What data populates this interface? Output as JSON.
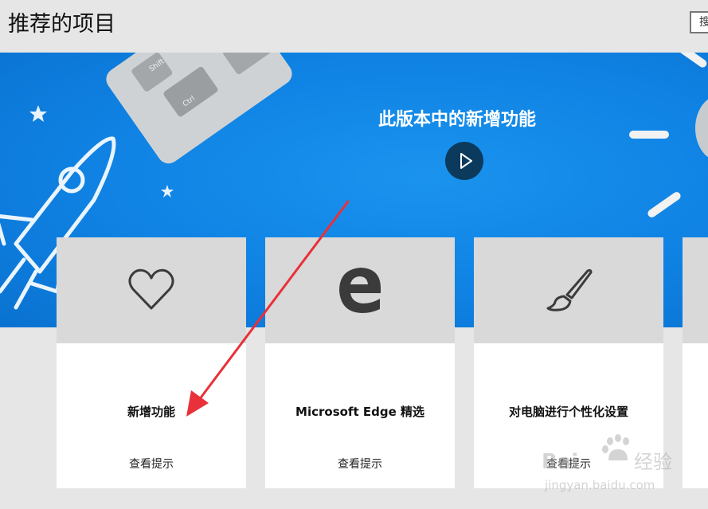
{
  "header": {
    "title": "推荐的项目",
    "search_label": "搜"
  },
  "hero": {
    "title": "此版本中的新增功能",
    "key_shift": "Shift",
    "key_ctrl": "Ctrl"
  },
  "cards": [
    {
      "title": "新增功能",
      "link": "查看提示",
      "icon": "heart-icon"
    },
    {
      "title": "Microsoft Edge 精选",
      "link": "查看提示",
      "icon": "edge-logo-icon"
    },
    {
      "title": "对电脑进行个性化设置",
      "link": "查看提示",
      "icon": "paintbrush-icon"
    }
  ],
  "watermark": {
    "brand": "Bai",
    "brand2": "经验",
    "url": "jingyan.baidu.com"
  },
  "colors": {
    "hero_blue": "#0f82e3",
    "play_button": "#0b3a5c",
    "annotation_arrow": "#e8313a"
  }
}
